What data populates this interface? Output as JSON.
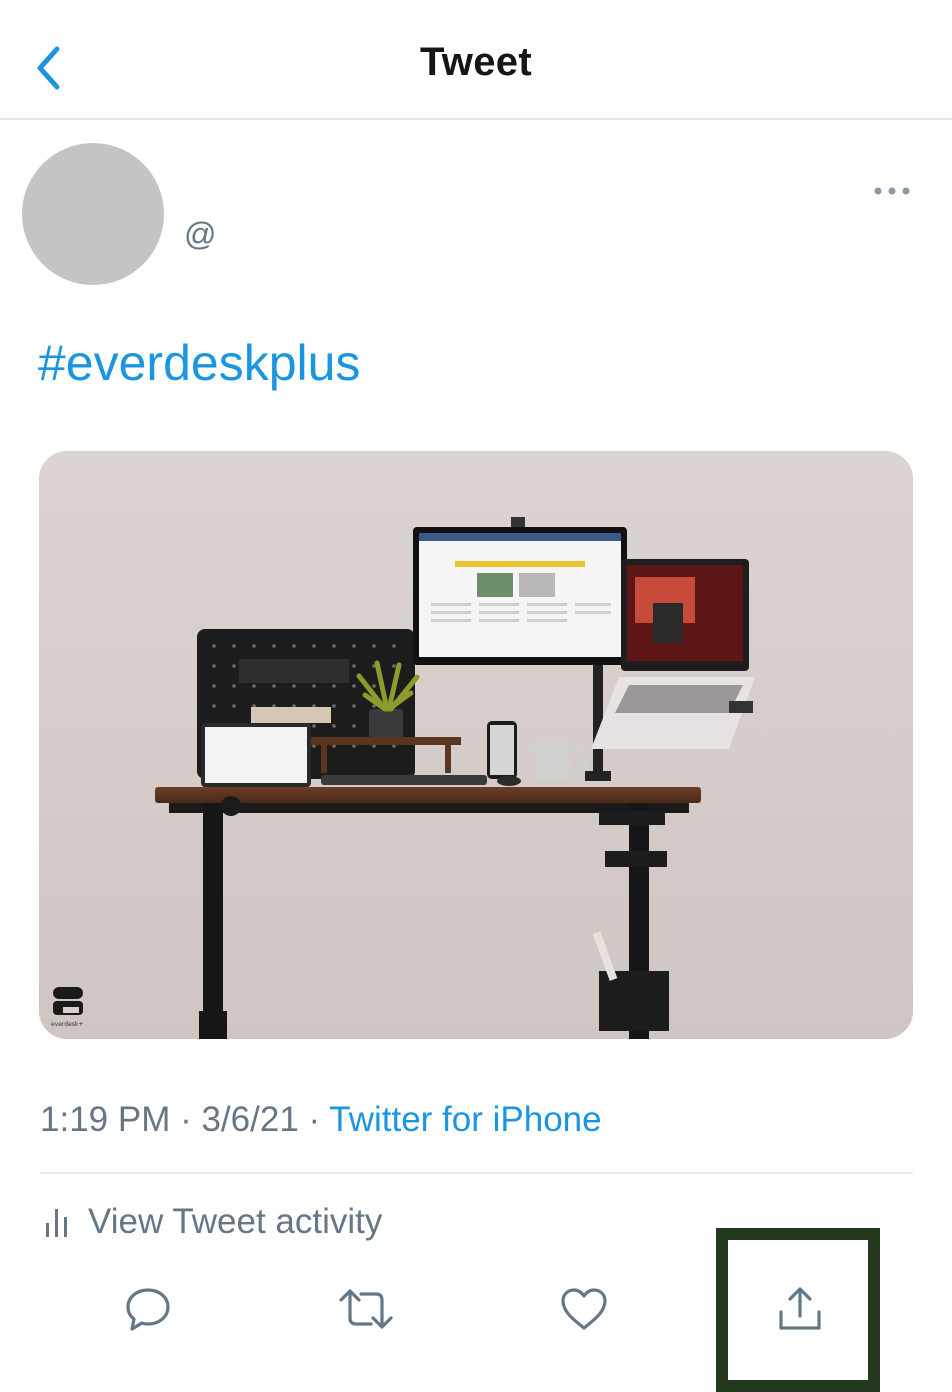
{
  "header": {
    "title": "Tweet",
    "back_icon": "chevron-left-icon"
  },
  "author": {
    "handle": "@",
    "more_icon": "more-horizontal-icon"
  },
  "tweet": {
    "text": "#everdeskplus",
    "media_description_icon": "photo",
    "watermark_text": "everdesk+"
  },
  "meta": {
    "time": "1:19 PM",
    "separator": " · ",
    "date": "3/6/21",
    "source": "Twitter for iPhone"
  },
  "activity": {
    "label": "View Tweet activity",
    "icon": "bar-chart-icon"
  },
  "actions": {
    "reply_icon": "reply-icon",
    "retweet_icon": "retweet-icon",
    "like_icon": "heart-icon",
    "share_icon": "share-icon"
  },
  "colors": {
    "accent": "#1b95e0",
    "secondary_text": "#657786",
    "highlight_border": "#253a1c"
  }
}
